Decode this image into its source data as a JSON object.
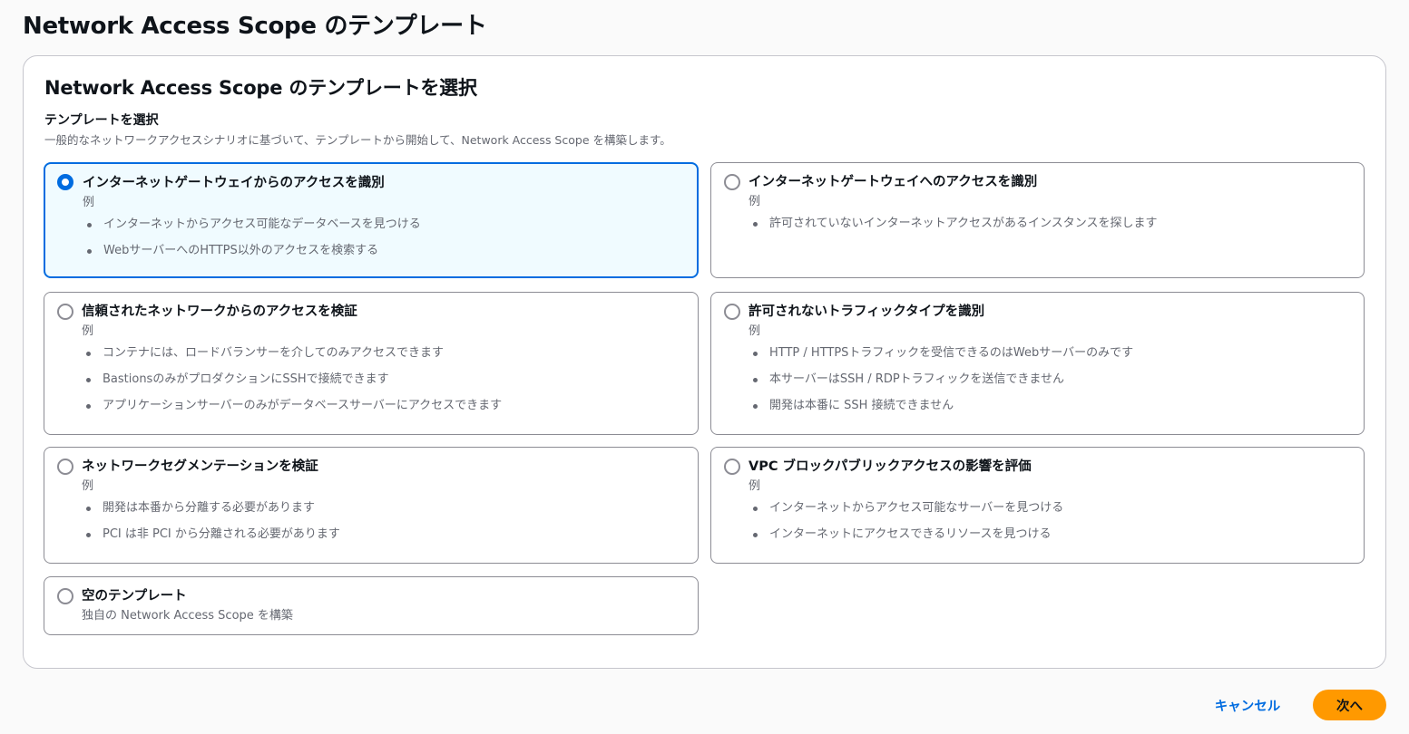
{
  "page": {
    "title": "Network Access Scope のテンプレート"
  },
  "panel": {
    "title": "Network Access Scope のテンプレートを選択",
    "field_label": "テンプレートを選択",
    "field_description": "一般的なネットワークアクセスシナリオに基づいて、テンプレートから開始して、Network Access Scope を構築します。"
  },
  "templates": [
    {
      "title": "インターネットゲートウェイからのアクセスを識別",
      "subtitle": "例",
      "selected": true,
      "examples": [
        "インターネットからアクセス可能なデータベースを見つける",
        "WebサーバーへのHTTPS以外のアクセスを検索する"
      ]
    },
    {
      "title": "インターネットゲートウェイへのアクセスを識別",
      "subtitle": "例",
      "selected": false,
      "examples": [
        "許可されていないインターネットアクセスがあるインスタンスを探します"
      ]
    },
    {
      "title": "信頼されたネットワークからのアクセスを検証",
      "subtitle": "例",
      "selected": false,
      "examples": [
        "コンテナには、ロードバランサーを介してのみアクセスできます",
        "BastionsのみがプロダクションにSSHで接続できます",
        "アプリケーションサーバーのみがデータベースサーバーにアクセスできます"
      ]
    },
    {
      "title": "許可されないトラフィックタイプを識別",
      "subtitle": "例",
      "selected": false,
      "examples": [
        "HTTP / HTTPSトラフィックを受信できるのはWebサーバーのみです",
        "本サーバーはSSH / RDPトラフィックを送信できません",
        "開発は本番に SSH 接続できません"
      ]
    },
    {
      "title": "ネットワークセグメンテーションを検証",
      "subtitle": "例",
      "selected": false,
      "examples": [
        "開発は本番から分離する必要があります",
        "PCI は非 PCI から分離される必要があります"
      ]
    },
    {
      "title": "VPC ブロックパブリックアクセスの影響を評価",
      "subtitle": "例",
      "selected": false,
      "examples": [
        "インターネットからアクセス可能なサーバーを見つける",
        "インターネットにアクセスできるリソースを見つける"
      ]
    },
    {
      "title": "空のテンプレート",
      "subtitle": "独自の Network Access Scope を構築",
      "selected": false,
      "examples": []
    }
  ],
  "actions": {
    "cancel_label": "キャンセル",
    "next_label": "次へ"
  },
  "colors": {
    "accent": "#006ce0",
    "primary_button": "#ff9900",
    "selected_tile_bg": "#f0fbff"
  }
}
